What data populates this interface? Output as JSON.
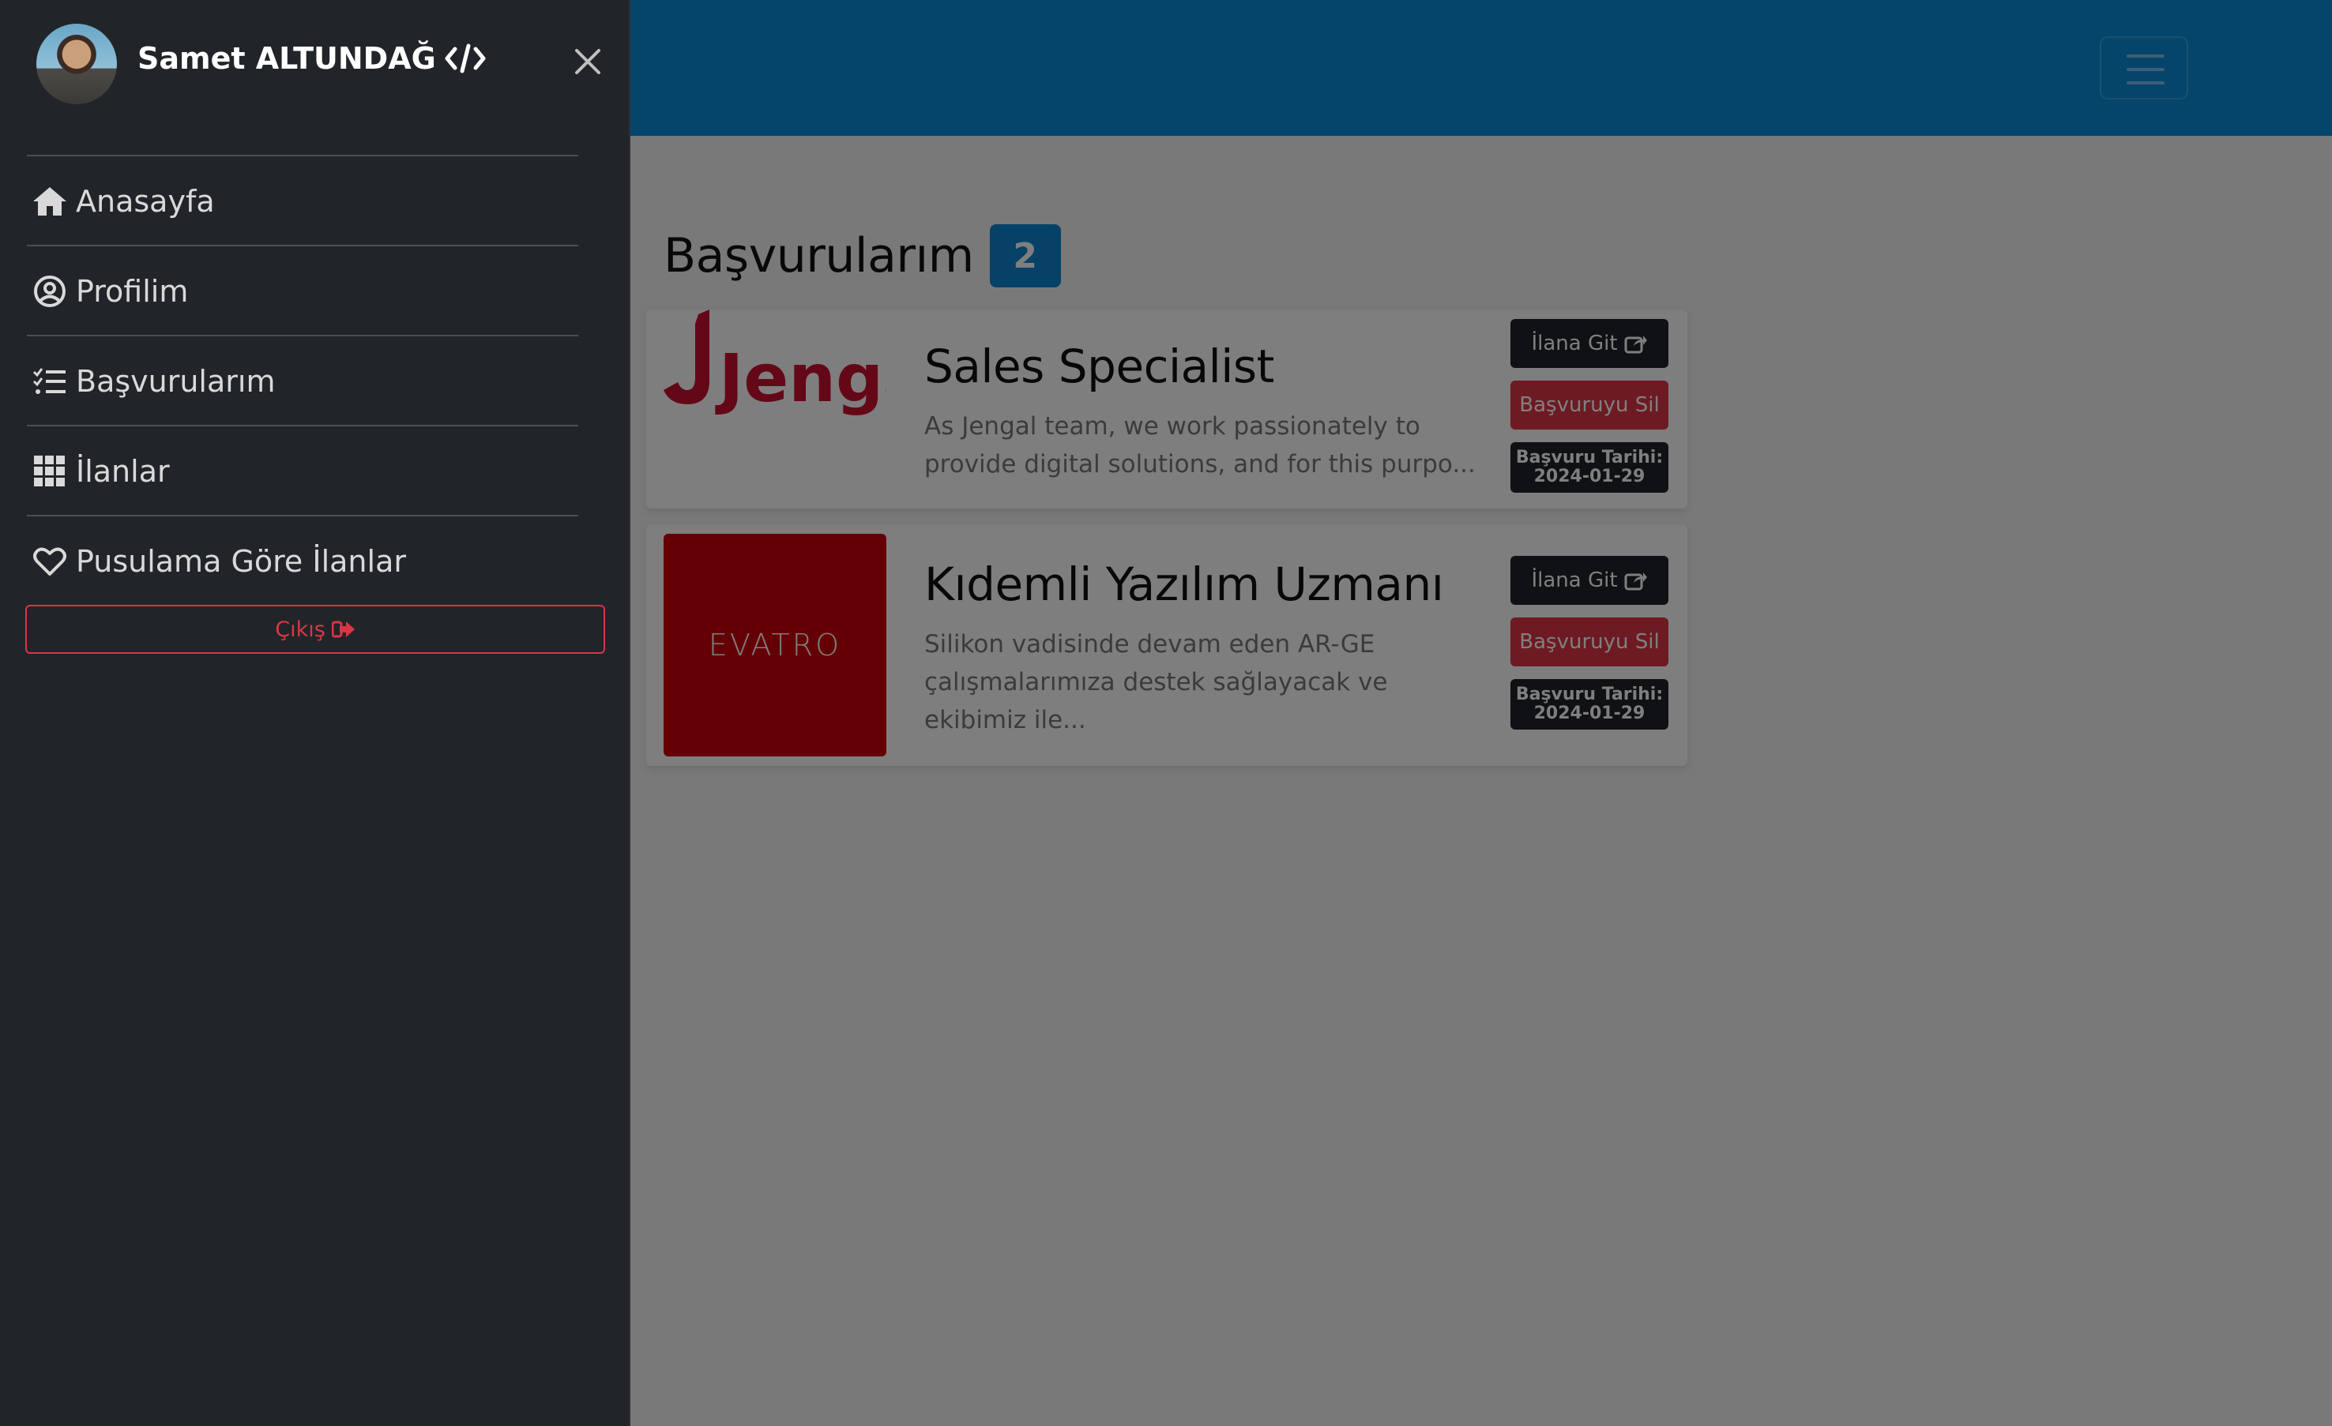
{
  "header": {
    "menu_toggle": "navbar-toggler"
  },
  "main": {
    "title": "Başvurularım",
    "count": "2",
    "applications": [
      {
        "company_logo_text": "Jengal",
        "title": "Sales Specialist",
        "description": "As Jengal team, we work passionately to provide digital solutions, and for this purpo...",
        "go_label": "İlana Git",
        "delete_label": "Başvuruyu Sil",
        "date_label": "Başvuru Tarihi:",
        "date_value": "2024-01-29"
      },
      {
        "company_logo_text": "EVATRO",
        "title": "Kıdemli Yazılım Uzmanı",
        "description": "Silikon vadisinde devam eden AR-GE çalışmalarımıza destek sağlayacak ve ekibimiz ile...",
        "go_label": "İlana Git",
        "delete_label": "Başvuruyu Sil",
        "date_label": "Başvuru Tarihi:",
        "date_value": "2024-01-29"
      }
    ]
  },
  "sidebar": {
    "user_name": "Samet ALTUNDAĞ",
    "items": [
      {
        "label": "Anasayfa",
        "icon": "home-icon"
      },
      {
        "label": "Profilim",
        "icon": "user-circle-icon"
      },
      {
        "label": "Başvurularım",
        "icon": "list-check-icon"
      },
      {
        "label": "İlanlar",
        "icon": "grid-icon"
      },
      {
        "label": "Pusulama Göre İlanlar",
        "icon": "heart-icon"
      }
    ],
    "logout_label": "Çıkış"
  },
  "colors": {
    "topbar": "#0a8bd6",
    "sidebar": "#212529",
    "danger": "#dc3545",
    "badge": "#0d84cf"
  }
}
